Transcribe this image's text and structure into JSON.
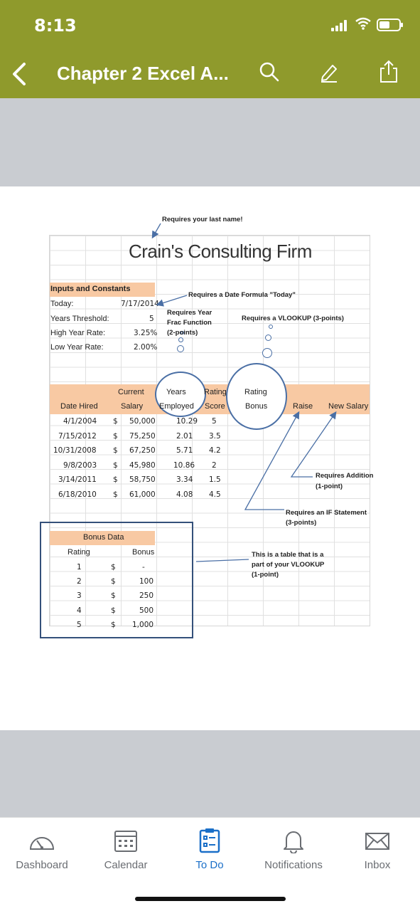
{
  "status_bar": {
    "time": "8:13"
  },
  "header": {
    "title": "Chapter 2 Excel A..."
  },
  "sheet": {
    "title": "Crain's Consulting Firm",
    "inputs_header": "Inputs and Constants",
    "inputs": [
      {
        "label": "Today:",
        "value": "7/17/2014"
      },
      {
        "label": "Years Threshold:",
        "value": "5"
      },
      {
        "label": "High Year Rate:",
        "value": "3.25%"
      },
      {
        "label": "Low Year Rate:",
        "value": "2.00%"
      }
    ],
    "columns": {
      "date_hired": "Date Hired",
      "current": "Current",
      "salary": "Salary",
      "years": "Years",
      "employed": "Employed",
      "rating": "Rating",
      "score": "Score",
      "rating_bonus_1": "Rating",
      "rating_bonus_2": "Bonus",
      "raise": "Raise",
      "new_salary": "New Salary"
    },
    "rows": [
      {
        "date": "4/1/2004",
        "cur": "$",
        "salary": "50,000",
        "years": "10.29",
        "score": "5"
      },
      {
        "date": "7/15/2012",
        "cur": "$",
        "salary": "75,250",
        "years": "2.01",
        "score": "3.5"
      },
      {
        "date": "10/31/2008",
        "cur": "$",
        "salary": "67,250",
        "years": "5.71",
        "score": "4.2"
      },
      {
        "date": "9/8/2003",
        "cur": "$",
        "salary": "45,980",
        "years": "10.86",
        "score": "2"
      },
      {
        "date": "3/14/2011",
        "cur": "$",
        "salary": "58,750",
        "years": "3.34",
        "score": "1.5"
      },
      {
        "date": "6/18/2010",
        "cur": "$",
        "salary": "61,000",
        "years": "4.08",
        "score": "4.5"
      }
    ],
    "bonus_title": "Bonus Data",
    "bonus_headers": {
      "rating": "Rating",
      "bonus": "Bonus"
    },
    "bonus_rows": [
      {
        "rating": "1",
        "cur": "$",
        "bonus": "-"
      },
      {
        "rating": "2",
        "cur": "$",
        "bonus": "100"
      },
      {
        "rating": "3",
        "cur": "$",
        "bonus": "250"
      },
      {
        "rating": "4",
        "cur": "$",
        "bonus": "500"
      },
      {
        "rating": "5",
        "cur": "$",
        "bonus": "1,000"
      }
    ]
  },
  "annotations": {
    "last_name": "Requires your last name!",
    "date_formula": "Requires a Date Formula \"Today\"",
    "yearfrac_1": "Requires Year",
    "yearfrac_2": "Frac Function",
    "yearfrac_3": "(2-points)",
    "vlookup": "Requires a VLOOKUP (3-points)",
    "addition_1": "Requires Addition",
    "addition_2": "(1-point)",
    "if_1": "Requires an IF Statement",
    "if_2": "(3-points)",
    "table_1": "This is a table that is a",
    "table_2": "part of your VLOOKUP",
    "table_3": "(1-point)"
  },
  "tabs": [
    {
      "label": "Dashboard",
      "icon": "dashboard-icon"
    },
    {
      "label": "Calendar",
      "icon": "calendar-icon"
    },
    {
      "label": "To Do",
      "icon": "todo-icon"
    },
    {
      "label": "Notifications",
      "icon": "bell-icon"
    },
    {
      "label": "Inbox",
      "icon": "mail-icon"
    }
  ],
  "colors": {
    "header": "#8f9a2c",
    "active_tab": "#1a6fc8",
    "peach": "#f8c9a3",
    "arrow": "#4a6fa5"
  }
}
